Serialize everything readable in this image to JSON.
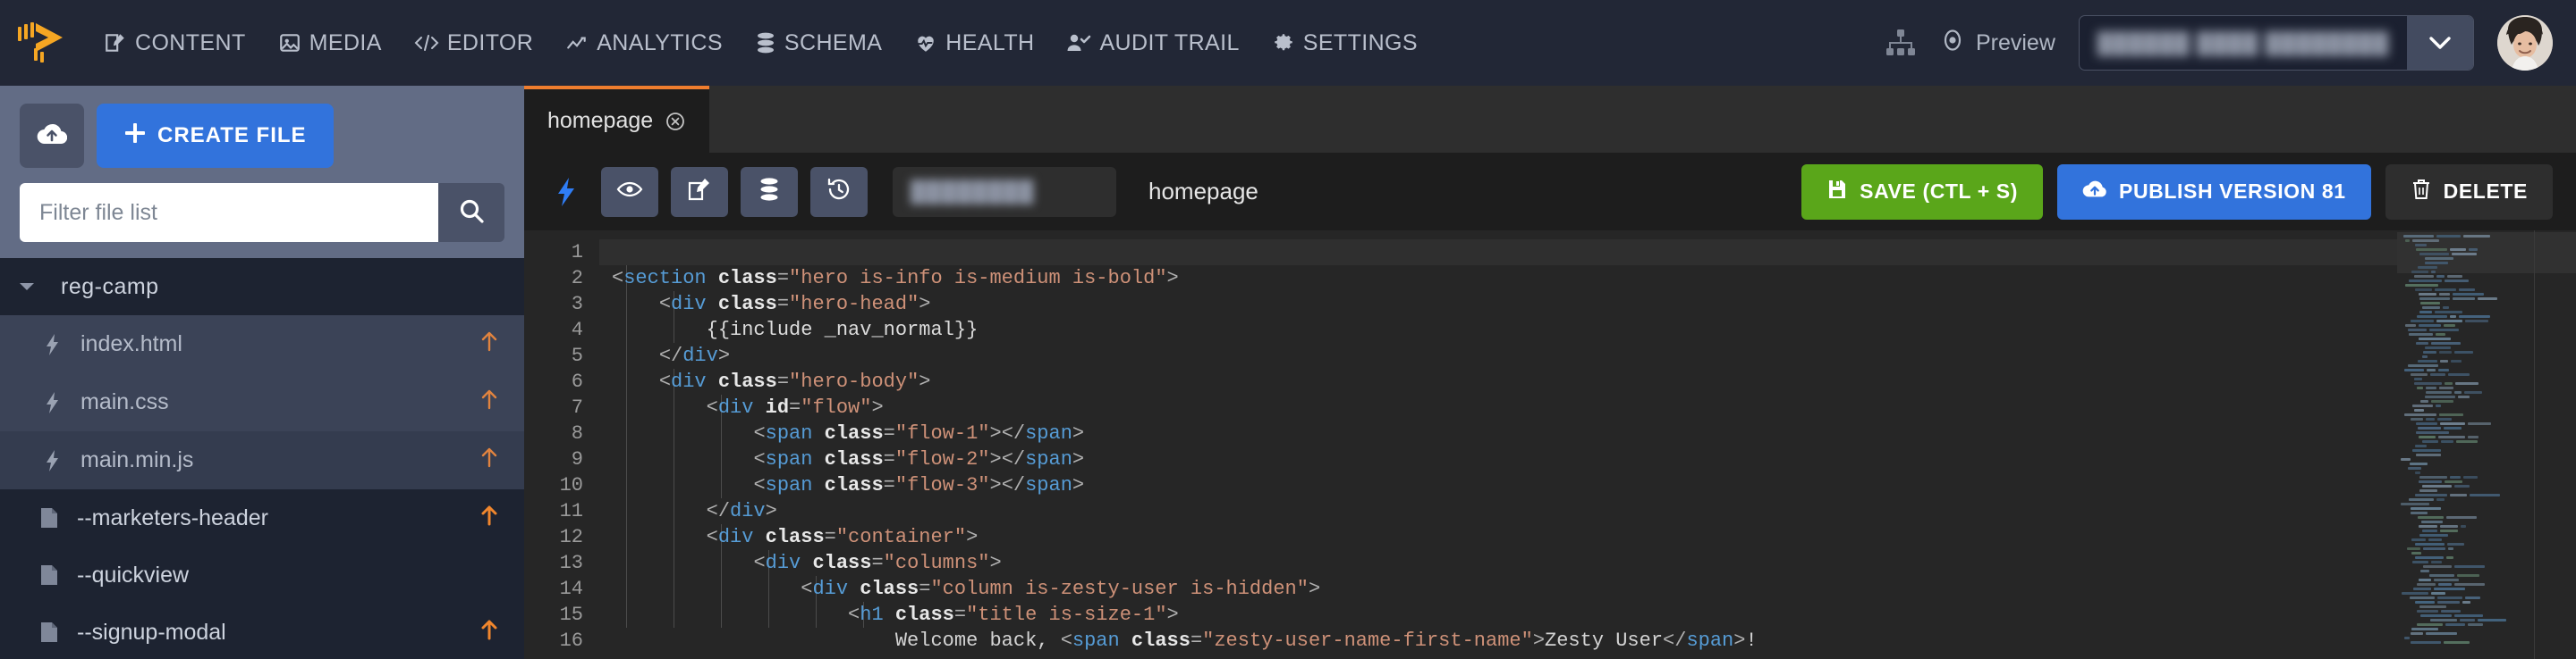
{
  "topnav": {
    "logo_name": "zesty-logo",
    "items": [
      {
        "label": "CONTENT",
        "icon": "content-edit-icon"
      },
      {
        "label": "MEDIA",
        "icon": "media-image-icon"
      },
      {
        "label": "EDITOR",
        "icon": "code-brackets-icon"
      },
      {
        "label": "ANALYTICS",
        "icon": "analytics-chart-icon"
      },
      {
        "label": "SCHEMA",
        "icon": "database-stack-icon"
      },
      {
        "label": "HEALTH",
        "icon": "heartbeat-icon"
      },
      {
        "label": "AUDIT TRAIL",
        "icon": "user-check-icon"
      },
      {
        "label": "SETTINGS",
        "icon": "gear-icon"
      }
    ],
    "sitemap_icon": "sitemap-icon",
    "preview_label": "Preview",
    "preview_icon": "eye-icon",
    "site_selector_value": "██████ ████ ████████",
    "site_selector_caret_icon": "chevron-down-icon",
    "avatar_name": "user-avatar"
  },
  "sidebar": {
    "upload_icon": "cloud-upload-icon",
    "create_file_label": "CREATE FILE",
    "create_file_icon": "plus-icon",
    "filter_placeholder": "Filter file list",
    "filter_value": "",
    "search_icon": "search-icon",
    "folder": {
      "name": "reg-camp",
      "caret_icon": "caret-down-icon"
    },
    "files": [
      {
        "name": "index.html",
        "icon": "lightning-icon",
        "badge": "arrow-up-icon"
      },
      {
        "name": "main.css",
        "icon": "lightning-icon",
        "badge": "arrow-up-icon"
      },
      {
        "name": "main.min.js",
        "icon": "lightning-icon",
        "badge": "arrow-up-icon"
      }
    ],
    "views": [
      {
        "name": "--marketers-header",
        "icon": "file-icon",
        "badge": "arrow-up-icon"
      },
      {
        "name": "--quickview",
        "icon": "file-icon",
        "badge": ""
      },
      {
        "name": "--signup-modal",
        "icon": "file-icon",
        "badge": "arrow-up-icon"
      }
    ]
  },
  "editor_panel": {
    "tab": {
      "label": "homepage",
      "close_icon": "close-circle-icon"
    },
    "toolbar": {
      "bolt_icon": "lightning-bolt-icon",
      "buttons": [
        {
          "icon": "eye-icon",
          "name": "view-button"
        },
        {
          "icon": "pencil-edit-icon",
          "name": "edit-button"
        },
        {
          "icon": "database-icon",
          "name": "database-button"
        },
        {
          "icon": "history-clock-icon",
          "name": "history-button"
        }
      ],
      "path_chip_value": "████████",
      "file_label": "homepage",
      "save_label": "SAVE (CTL + S)",
      "save_icon": "save-disk-icon",
      "save_color": "#5aa61a",
      "publish_label": "PUBLISH VERSION 81",
      "publish_icon": "cloud-upload-icon",
      "publish_color": "#3273dc",
      "delete_label": "DELETE",
      "delete_icon": "trash-icon"
    },
    "code": {
      "line_numbers": [
        1,
        2,
        3,
        4,
        5,
        6,
        7,
        8,
        9,
        10,
        11,
        12,
        13,
        14,
        15,
        16
      ],
      "lines": [
        "",
        "<section class=\"hero is-info is-medium is-bold\">",
        "    <div class=\"hero-head\">",
        "        {{include _nav_normal}}",
        "    </div>",
        "    <div class=\"hero-body\">",
        "        <div id=\"flow\">",
        "            <span class=\"flow-1\"></span>",
        "            <span class=\"flow-2\"></span>",
        "            <span class=\"flow-3\"></span>",
        "        </div>",
        "        <div class=\"container\">",
        "            <div class=\"columns\">",
        "                <div class=\"column is-zesty-user is-hidden\">",
        "                    <h1 class=\"title is-size-1\">",
        "                        Welcome back, <span class=\"zesty-user-name-first-name\">Zesty User</span>!"
      ]
    },
    "minimap_name": "code-minimap"
  },
  "colors": {
    "topnav_bg": "#222736",
    "sidebar_bg": "#626c85",
    "editor_bg": "#262626",
    "accent_orange": "#ef7d2e",
    "accent_blue": "#3273dc",
    "accent_green": "#5aa61a"
  }
}
